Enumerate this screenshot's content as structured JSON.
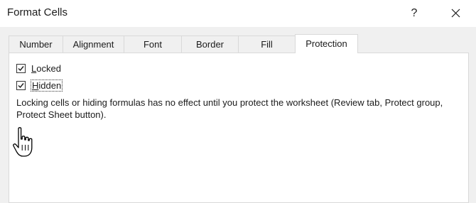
{
  "window": {
    "title": "Format Cells",
    "help_glyph": "?"
  },
  "tabs": [
    {
      "label": "Number",
      "active": false
    },
    {
      "label": "Alignment",
      "active": false
    },
    {
      "label": "Font",
      "active": false
    },
    {
      "label": "Border",
      "active": false
    },
    {
      "label": "Fill",
      "active": false
    },
    {
      "label": "Protection",
      "active": true
    }
  ],
  "protection": {
    "locked": {
      "label": "Locked",
      "checked": true
    },
    "hidden": {
      "label": "Hidden",
      "checked": true
    },
    "note": "Locking cells or hiding formulas has no effect until you protect the worksheet (Review tab, Protect group, Protect Sheet button)."
  },
  "icons": {
    "close": "close-icon",
    "check": "checkmark-icon",
    "cursor": "hand-pointer-cursor-icon"
  },
  "colors": {
    "dialog_background": "#f0f0f0",
    "panel_background": "#ffffff",
    "border": "#d9d9d9",
    "text": "#1b1b1b"
  }
}
